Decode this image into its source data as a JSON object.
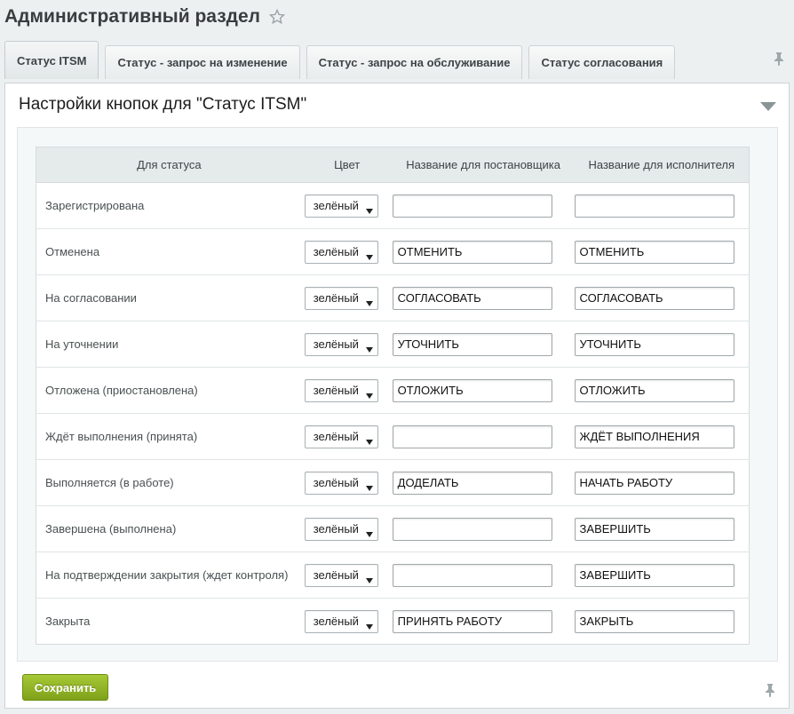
{
  "page": {
    "title": "Административный раздел"
  },
  "tabs": [
    {
      "label": "Статус ITSM",
      "active": true
    },
    {
      "label": "Статус - запрос на изменение",
      "active": false
    },
    {
      "label": "Статус - запрос на обслуживание",
      "active": false
    },
    {
      "label": "Статус согласования",
      "active": false
    }
  ],
  "panel": {
    "title": "Настройки кнопок для \"Статус ITSM\""
  },
  "table": {
    "headers": [
      "Для статуса",
      "Цвет",
      "Название для постановщика",
      "Название для исполнителя"
    ],
    "rows": [
      {
        "status": "Зарегистрирована",
        "color": "зелёный",
        "requester": "",
        "executor": ""
      },
      {
        "status": "Отменена",
        "color": "зелёный",
        "requester": "ОТМЕНИТЬ",
        "executor": "ОТМЕНИТЬ"
      },
      {
        "status": "На согласовании",
        "color": "зелёный",
        "requester": "СОГЛАСОВАТЬ",
        "executor": "СОГЛАСОВАТЬ"
      },
      {
        "status": "На уточнении",
        "color": "зелёный",
        "requester": "УТОЧНИТЬ",
        "executor": "УТОЧНИТЬ"
      },
      {
        "status": "Отложена (приостановлена)",
        "color": "зелёный",
        "requester": "ОТЛОЖИТЬ",
        "executor": "ОТЛОЖИТЬ"
      },
      {
        "status": "Ждёт выполнения (принята)",
        "color": "зелёный",
        "requester": "",
        "executor": "ЖДЁТ ВЫПОЛНЕНИЯ"
      },
      {
        "status": "Выполняется (в работе)",
        "color": "зелёный",
        "requester": "ДОДЕЛАТЬ",
        "executor": "НАЧАТЬ РАБОТУ"
      },
      {
        "status": "Завершена (выполнена)",
        "color": "зелёный",
        "requester": "",
        "executor": "ЗАВЕРШИТЬ"
      },
      {
        "status": "На подтверждении закрытия (ждет контроля)",
        "color": "зелёный",
        "requester": "",
        "executor": "ЗАВЕРШИТЬ"
      },
      {
        "status": "Закрыта",
        "color": "зелёный",
        "requester": "ПРИНЯТЬ РАБОТУ",
        "executor": "ЗАКРЫТЬ"
      }
    ]
  },
  "actions": {
    "save_label": "Сохранить"
  },
  "icons": {
    "favorite": "star-icon",
    "pin": "pin-icon",
    "collapse": "chevron-down-icon",
    "dropdown": "caret-down-icon"
  },
  "colors": {
    "save_button": "#8db42a",
    "tab_bg": "#eef1f1",
    "header_bg": "#e5eaeb"
  }
}
